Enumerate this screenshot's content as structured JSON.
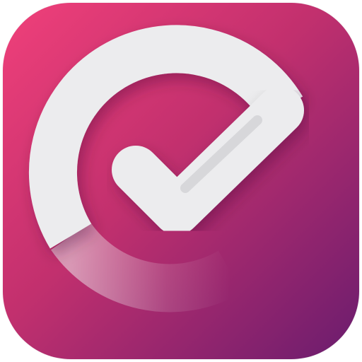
{
  "icon": {
    "glyph": "check-ring-icon",
    "colors": {
      "gradient_start": "#f0407a",
      "gradient_mid": "#c2306e",
      "gradient_end": "#6a1c6e",
      "mark": "#ececee",
      "mark_shadow": "#c9c9cd"
    }
  }
}
